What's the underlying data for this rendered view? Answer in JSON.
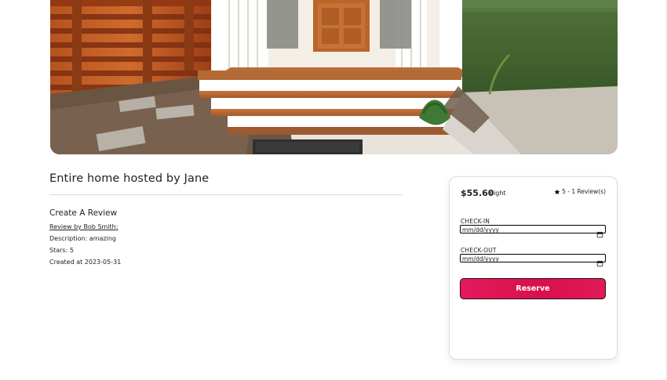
{
  "listing": {
    "host_title": "Entire home hosted by Jane"
  },
  "review": {
    "section_title": "Create A Review",
    "author_link": "Review by Bob Smith:",
    "description": "Description: amazing",
    "stars": "Stars: 5",
    "created_at": "Created at 2023-05-31"
  },
  "booking": {
    "price": "$55.60",
    "per_night": "night",
    "rating_text": "5 - 1 Review(s)",
    "checkin_label": "CHECK-IN",
    "checkout_label": "CHECK-OUT",
    "date_placeholder": "mm/dd/yyyy",
    "reserve_label": "Reserve"
  }
}
